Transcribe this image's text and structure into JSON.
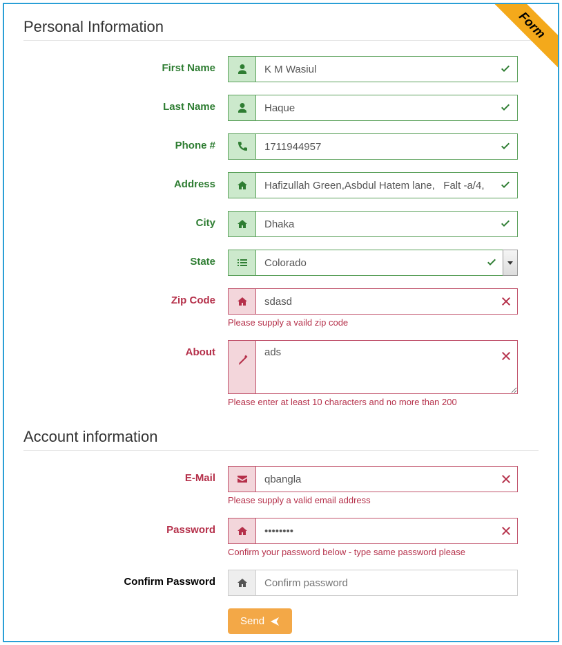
{
  "ribbon": "Form",
  "sections": {
    "personal": {
      "title": "Personal Information"
    },
    "account": {
      "title": "Account information"
    }
  },
  "fields": {
    "first_name": {
      "label": "First Name",
      "value": "K M Wasiul"
    },
    "last_name": {
      "label": "Last Name",
      "value": "Haque"
    },
    "phone": {
      "label": "Phone #",
      "value": "1711944957"
    },
    "address": {
      "label": "Address",
      "value": "Hafizullah Green,Asbdul Hatem lane,   Falt -a/4,"
    },
    "city": {
      "label": "City",
      "value": "Dhaka"
    },
    "state": {
      "label": "State",
      "value": "Colorado"
    },
    "zip": {
      "label": "Zip Code",
      "value": "sdasd",
      "help": "Please supply a vaild zip code"
    },
    "about": {
      "label": "About",
      "value": "ads",
      "help": "Please enter at least 10 characters and no more than 200"
    },
    "email": {
      "label": "E-Mail",
      "value": "qbangla",
      "help": "Please supply a valid email address"
    },
    "password": {
      "label": "Password",
      "value": "••••••••",
      "help": "Confirm your password below - type same password please"
    },
    "confirm": {
      "label": "Confirm Password",
      "placeholder": "Confirm password"
    }
  },
  "button": {
    "send": "Send"
  }
}
